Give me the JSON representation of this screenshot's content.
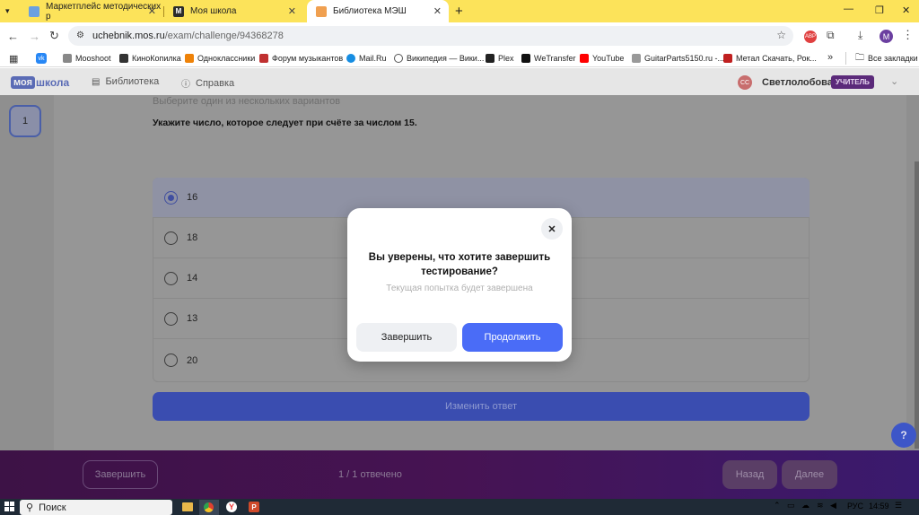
{
  "browser": {
    "tabs": [
      {
        "title": "Маркетплейс методических р",
        "favicon_color": "#4a8ad8"
      },
      {
        "title": "Моя школа",
        "favicon_color": "#2b2b2b",
        "favicon_letter": "M"
      },
      {
        "title": "Библиотека МЭШ",
        "favicon_color": "#f0a050",
        "active": true
      }
    ],
    "new_tab_label": "+",
    "address": {
      "domain": "uchebnik.mos.ru",
      "path": "/exam/challenge/94368278"
    },
    "profile_letter": "M",
    "bookmarks": [
      "Mooshoot",
      "КиноКопилка",
      "Одноклассники",
      "Форум музыкантов",
      "Mail.Ru",
      "Википедия — Вики...",
      "Plex",
      "WeTransfer",
      "YouTube",
      "GuitarParts5150.ru -...",
      "Метал Скачать, Рок..."
    ],
    "all_bookmarks_label": "Все закладки",
    "more_bookmarks": "»"
  },
  "app": {
    "logo_part1": "моя",
    "logo_part2": "школа",
    "nav_library": "Библиотека",
    "nav_help": "Справка",
    "user_initials": "СС",
    "user_name": "Светлолобова",
    "role_badge": "УЧИТЕЛЬ"
  },
  "question": {
    "number": "1",
    "instruction": "Выберите один из нескольких вариантов",
    "text": "Укажите число, которое следует при счёте за числом 15.",
    "options": [
      "16",
      "18",
      "14",
      "13",
      "20"
    ],
    "selected_index": 0,
    "change_answer_label": "Изменить ответ"
  },
  "footer": {
    "finish_label": "Завершить",
    "progress_text": "1 / 1 отвечено",
    "back_label": "Назад",
    "next_label": "Далее",
    "help_label": "?"
  },
  "modal": {
    "title": "Вы уверены, что хотите  завершить тестирование?",
    "subtitle": "Текущая попытка будет завершена",
    "finish_label": "Завершить",
    "continue_label": "Продолжить",
    "close_label": "✕"
  },
  "taskbar": {
    "search_label": "Поиск",
    "language": "РУС",
    "time": "14:59"
  },
  "colors": {
    "tabstrip": "#fce35a",
    "accent_blue": "#4a6cf7",
    "dimmed_button": "#3a4db0",
    "footer_purple": "#461353",
    "role_badge": "#5b2a7a"
  }
}
